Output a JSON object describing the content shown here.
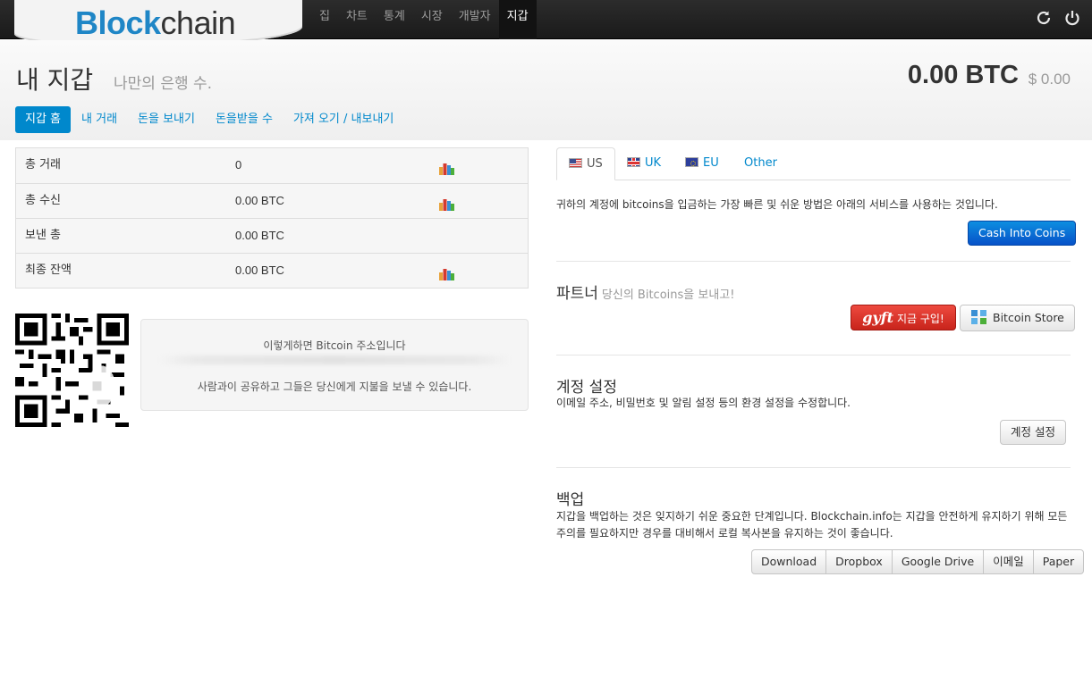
{
  "nav": {
    "logo_part1": "Blo",
    "logo_part2": "ck",
    "logo_part3": "chain",
    "items": [
      {
        "label": "집"
      },
      {
        "label": "차트"
      },
      {
        "label": "통계"
      },
      {
        "label": "시장"
      },
      {
        "label": "개발자"
      },
      {
        "label": "지갑"
      }
    ],
    "active_item": "지갑",
    "refresh_icon": "refresh-icon",
    "power_icon": "power-icon"
  },
  "header": {
    "title": "내 지갑",
    "subtitle": "나만의 은행 수.",
    "balance_btc": "0.00 BTC",
    "balance_usd": "$ 0.00"
  },
  "tabs": [
    {
      "label": "지갑 홈",
      "active": true
    },
    {
      "label": "내 거래"
    },
    {
      "label": "돈을 보내기"
    },
    {
      "label": "돈을받을 수"
    },
    {
      "label": "가져 오기 / 내보내기"
    }
  ],
  "stats": [
    {
      "label": "총 거래",
      "value": "0",
      "chart": true
    },
    {
      "label": "총 수신",
      "value": "0.00 BTC",
      "chart": true
    },
    {
      "label": "보낸 총",
      "value": "0.00 BTC",
      "chart": false
    },
    {
      "label": "최종 잔액",
      "value": "0.00 BTC",
      "chart": true
    }
  ],
  "address_box": {
    "title": "이렇게하면 Bitcoin 주소입니다",
    "share_text": "사람과이 공유하고 그들은 당신에게 지불을 보낼 수 있습니다."
  },
  "country_tabs": [
    {
      "label": "US",
      "flag": "us-flag-icon",
      "active": true
    },
    {
      "label": "UK",
      "flag": "uk-flag-icon"
    },
    {
      "label": "EU",
      "flag": "eu-flag-icon"
    },
    {
      "label": "Other"
    }
  ],
  "deposit": {
    "text": "귀하의 계정에 bitcoins을 입금하는 가장 빠른 및 쉬운 방법은 아래의 서비스를 사용하는 것입니다.",
    "button": "Cash Into Coins"
  },
  "partners": {
    "title": "파트너",
    "subtitle": "당신의 Bitcoins을 보내고!",
    "gyft_logo": "gyft",
    "gyft_label": "지금 구입!",
    "store_label": "Bitcoin Store"
  },
  "account": {
    "title": "계정 설정",
    "desc": "이메일 주소, 비밀번호 및 알림 설정 등의 환경 설정을 수정합니다.",
    "button": "계정 설정"
  },
  "backup": {
    "title": "백업",
    "desc": "지갑을 백업하는 것은 잊지하기 쉬운 중요한 단계입니다. Blockchain.info는 지갑을 안전하게 유지하기 위해 모든주의를 필요하지만 경우를 대비해서 로컬 복사본을 유지하는 것이 좋습니다.",
    "buttons": [
      "Download",
      "Dropbox",
      "Google Drive",
      "이메일",
      "Paper"
    ]
  },
  "colors": {
    "accent": "#0088cc",
    "topbar": "#1b1b1b",
    "primary_button": "#0752c9",
    "gyft_red": "#d8302a"
  }
}
